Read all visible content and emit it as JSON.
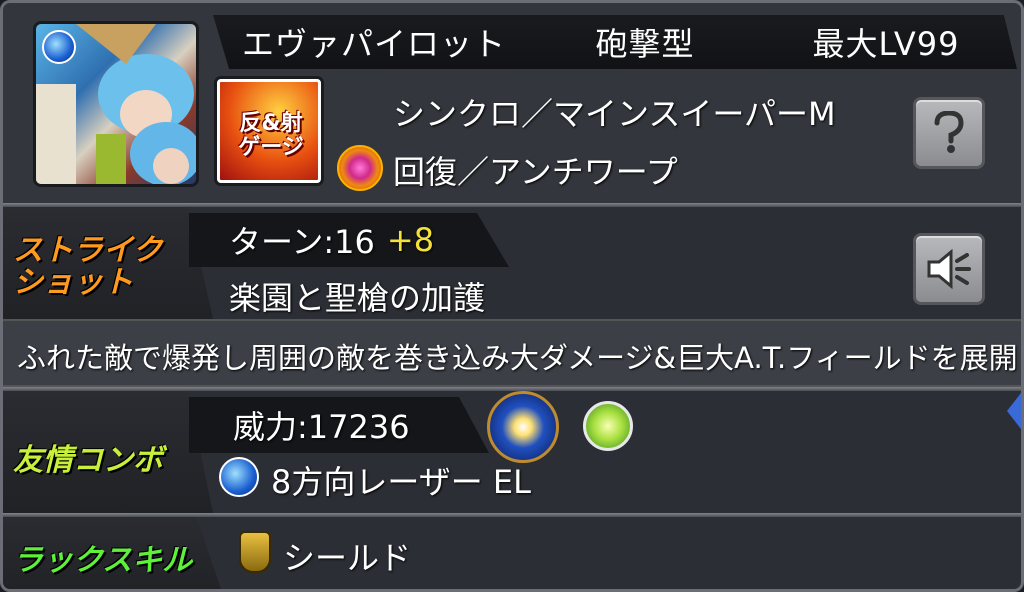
{
  "header": {
    "race": "エヴァパイロット",
    "type": "砲撃型",
    "max_level": "最大LV99"
  },
  "abilities": {
    "main": "シンクロ／マインスイーパーM",
    "gauge": "回復／アンチワープ",
    "gauge_badge": "反射ゲージ"
  },
  "strike_shot": {
    "label": "ストライクショット",
    "turn": "ターン:16",
    "turn_bonus": "+8",
    "name": "楽園と聖槍の加護",
    "description": "ふれた敵で爆発し周囲の敵を巻き込み大ダメージ&巨大A.T.フィールドを展開"
  },
  "friend_combo": {
    "label": "友情コンボ",
    "power": "威力:17236",
    "name": "8方向レーザー EL"
  },
  "luck_skill": {
    "label": "ラックスキル",
    "name": "シールド"
  },
  "colors": {
    "strike_label": "#ff9a1f",
    "friend_label": "#c8f03a",
    "luck_label": "#5ef03a",
    "turn_bonus": "#f2e23a"
  },
  "icons": {
    "help": "question-icon",
    "voice": "speaker-icon"
  }
}
